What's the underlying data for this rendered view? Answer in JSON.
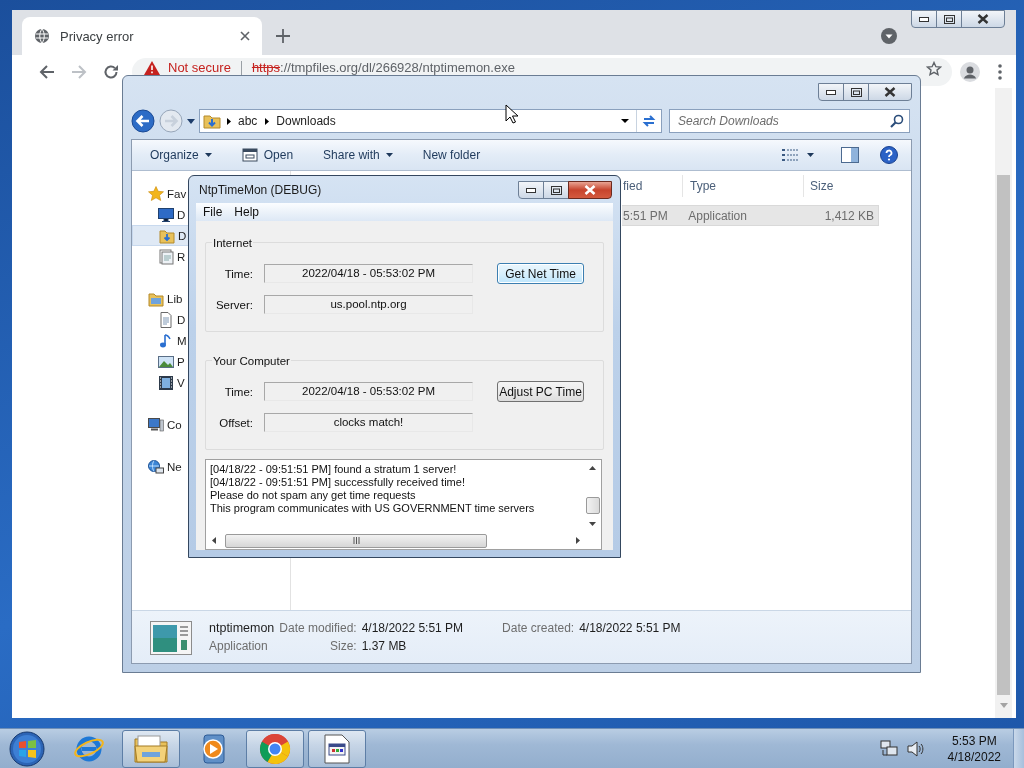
{
  "browser": {
    "tabs": [
      {
        "title": "Privacy error",
        "selected": true
      }
    ],
    "security": "Not secure",
    "url": {
      "scheme": "https",
      "rest": "://tmpfiles.org/dl/266928/ntptimemon.exe"
    }
  },
  "explorer": {
    "path": [
      "abc",
      "Downloads"
    ],
    "search": {
      "placeholder": "Search Downloads"
    },
    "toolbar": [
      {
        "label": "Organize",
        "kind": "menu"
      },
      {
        "label": "Open",
        "kind": "app"
      },
      {
        "label": "Share with",
        "kind": "menu"
      },
      {
        "label": "New folder",
        "kind": "plain"
      }
    ],
    "nav": [
      {
        "label": "Fav",
        "kind": "star",
        "selected": false,
        "children": [
          {
            "label": "D",
            "kind": "desktop",
            "selected": false
          },
          {
            "label": "D",
            "kind": "downloads",
            "selected": true
          },
          {
            "label": "R",
            "kind": "recent",
            "selected": false
          }
        ]
      },
      {
        "label": "Lib",
        "kind": "library",
        "selected": false,
        "children": [
          {
            "label": "D",
            "kind": "documents",
            "selected": false
          },
          {
            "label": "M",
            "kind": "music",
            "selected": false
          },
          {
            "label": "P",
            "kind": "pictures",
            "selected": false
          },
          {
            "label": "V",
            "kind": "videos",
            "selected": false
          }
        ]
      },
      {
        "label": "Co",
        "kind": "computer",
        "selected": false
      },
      {
        "label": "Ne",
        "kind": "network",
        "selected": false
      }
    ],
    "columns": [
      "fied",
      "Type",
      "Size"
    ],
    "rows": [
      {
        "cells": [
          "5:51 PM",
          "Application",
          "1,412 KB"
        ],
        "selected": true
      }
    ],
    "details": {
      "name": "ntptimemon",
      "type": "Application",
      "properties": [
        {
          "label": "Date modified:",
          "value": "4/18/2022 5:51 PM"
        },
        {
          "label": "Date created:",
          "value": "4/18/2022 5:51 PM"
        },
        {
          "label": "Size:",
          "value": "1.37 MB"
        }
      ]
    }
  },
  "app": {
    "title": "NtpTimeMon (DEBUG)",
    "menu": [
      "File",
      "Help"
    ],
    "groups": [
      {
        "title": "Internet",
        "fields": [
          {
            "label": "Time:",
            "value": "2022/04/18 - 05:53:02 PM"
          },
          {
            "label": "Server:",
            "value": "us.pool.ntp.org"
          }
        ],
        "button": {
          "label": "Get Net Time",
          "focused": true
        }
      },
      {
        "title": "Your Computer",
        "fields": [
          {
            "label": "Time:",
            "value": "2022/04/18 - 05:53:02 PM"
          },
          {
            "label": "Offset:",
            "value": "clocks match!"
          }
        ],
        "button": {
          "label": "Adjust PC Time",
          "focused": false
        }
      }
    ],
    "log": [
      "[04/18/22 - 09:51:51 PM] found a stratum 1 server!",
      "[04/18/22 - 09:51:51 PM] successfully received time!",
      "Please do not spam any get time requests",
      "This program communicates with US GOVERNMENT time servers"
    ]
  },
  "taskbar": {
    "apps": [
      {
        "kind": "ie",
        "open": false
      },
      {
        "kind": "explorer",
        "open": true
      },
      {
        "kind": "media",
        "open": false
      },
      {
        "kind": "chrome",
        "open": true
      },
      {
        "kind": "program",
        "open": true
      }
    ],
    "clock": {
      "time": "5:53 PM",
      "date": "4/18/2022"
    }
  }
}
